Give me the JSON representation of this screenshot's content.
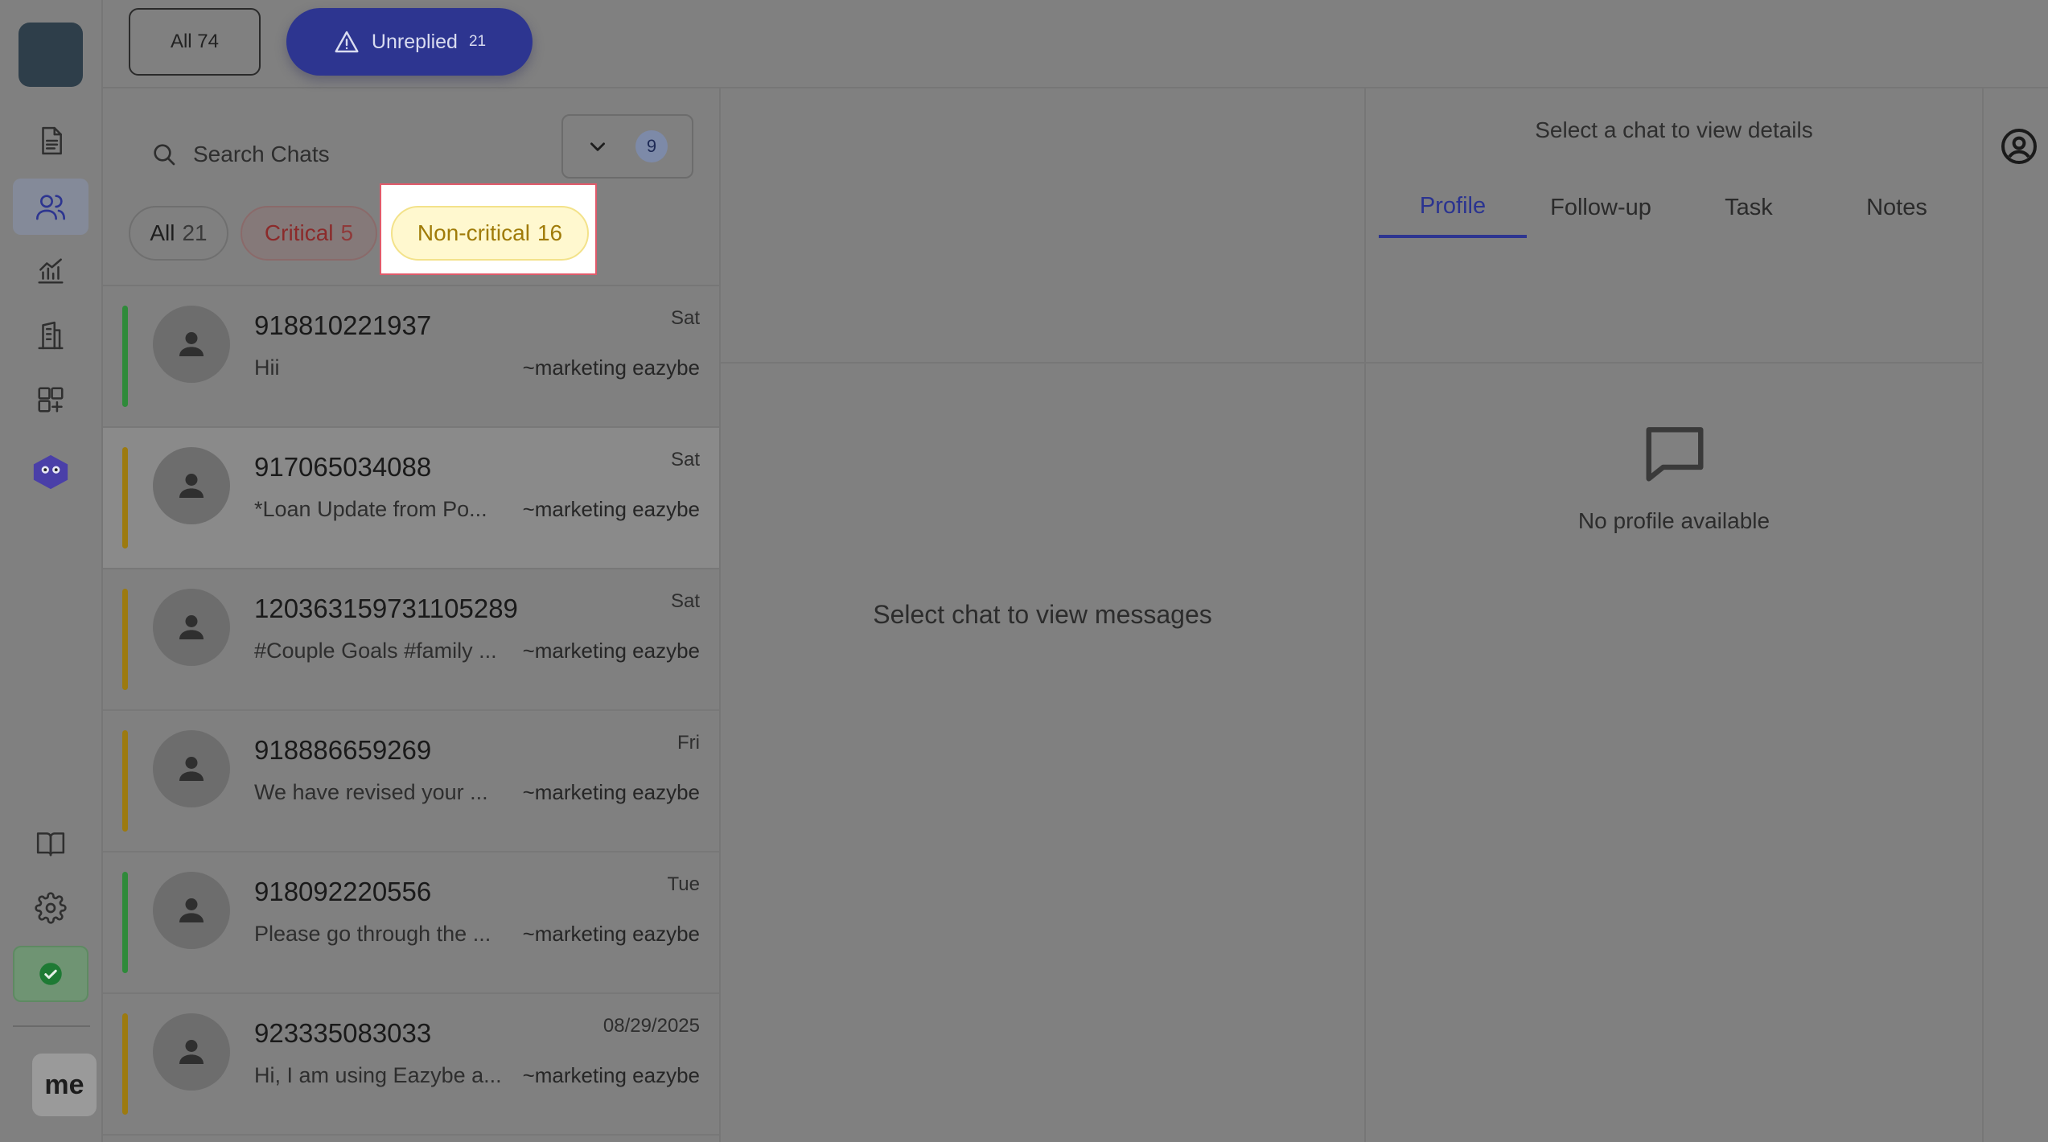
{
  "topbar": {
    "all_label": "All 74",
    "unreplied_label": "Unreplied",
    "unreplied_count": "21"
  },
  "search": {
    "placeholder": "Search Chats",
    "filter_count": "9"
  },
  "filters": {
    "all_label": "All",
    "all_count": "21",
    "critical_label": "Critical",
    "critical_count": "5",
    "noncritical_label": "Non-critical",
    "noncritical_count": "16"
  },
  "chats": [
    {
      "name": "918810221937",
      "time": "Sat",
      "preview": "Hii",
      "owner": "~marketing eazybe",
      "status_color": "#2f8a3a"
    },
    {
      "name": "917065034088",
      "time": "Sat",
      "preview": "*Loan Update from Po...",
      "owner": "~marketing eazybe",
      "status_color": "#9c7a10"
    },
    {
      "name": "120363159731105289",
      "time": "Sat",
      "preview": "#Couple Goals #family ...",
      "owner": "~marketing eazybe",
      "status_color": "#9c7a10"
    },
    {
      "name": "918886659269",
      "time": "Fri",
      "preview": "We have revised your ...",
      "owner": "~marketing eazybe",
      "status_color": "#9c7a10"
    },
    {
      "name": "918092220556",
      "time": "Tue",
      "preview": "Please go through the ...",
      "owner": "~marketing eazybe",
      "status_color": "#2f8a3a"
    },
    {
      "name": "923335083033",
      "time": "08/29/2025",
      "preview": "Hi, I am using Eazybe a...",
      "owner": "~marketing eazybe",
      "status_color": "#9c7a10"
    }
  ],
  "messages": {
    "empty_text": "Select chat to view messages"
  },
  "details": {
    "hint": "Select a chat to view details",
    "tabs": [
      "Profile",
      "Follow-up",
      "Task",
      "Notes"
    ],
    "no_profile": "No profile available"
  },
  "user": {
    "initials": "me"
  },
  "colors": {
    "accent": "#2d3590",
    "critical": "#8b2a2a",
    "noncritical": "#a07b08",
    "online": "#1e7a34"
  }
}
